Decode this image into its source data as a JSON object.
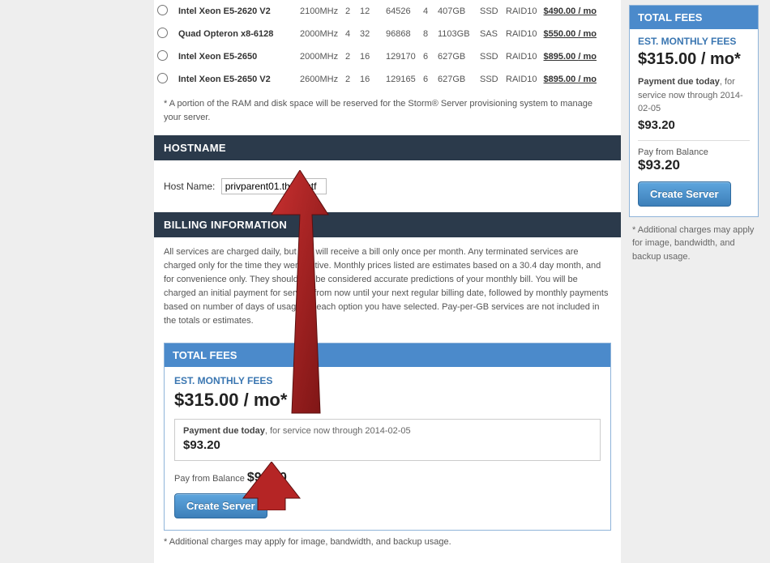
{
  "servers": [
    {
      "name": "Intel Xeon E5-2620 V2",
      "mhz": "2100MHz",
      "cpus": "2",
      "cores": "12",
      "ram": "64526",
      "drives": "4",
      "disk": "407GB",
      "type": "SSD",
      "raid": "RAID10",
      "price": "$490.00",
      "per": "/ mo"
    },
    {
      "name": "Quad Opteron x8-6128",
      "mhz": "2000MHz",
      "cpus": "4",
      "cores": "32",
      "ram": "96868",
      "drives": "8",
      "disk": "1103GB",
      "type": "SAS",
      "raid": "RAID10",
      "price": "$550.00",
      "per": "/ mo"
    },
    {
      "name": "Intel Xeon E5-2650",
      "mhz": "2000MHz",
      "cpus": "2",
      "cores": "16",
      "ram": "129170",
      "drives": "6",
      "disk": "627GB",
      "type": "SSD",
      "raid": "RAID10",
      "price": "$895.00",
      "per": "/ mo"
    },
    {
      "name": "Intel Xeon E5-2650 V2",
      "mhz": "2600MHz",
      "cpus": "2",
      "cores": "16",
      "ram": "129165",
      "drives": "6",
      "disk": "627GB",
      "type": "SSD",
      "raid": "RAID10",
      "price": "$895.00",
      "per": "/ mo"
    }
  ],
  "disclaimer": "* A portion of the RAM and disk space will be reserved for the Storm® Server provisioning system to manage your server.",
  "hostname": {
    "header": "HOSTNAME",
    "label": "Host Name:",
    "value": "privparent01.thebestf"
  },
  "billing": {
    "header": "BILLING INFORMATION",
    "text": "All services are charged daily, but you will receive a bill only once per month. Any terminated services are charged only for the time they were active. Monthly prices listed are estimates based on a 30.4 day month, and for convenience only. They should not be considered accurate predictions of your monthly bill. You will be charged an initial payment for service from now until your next regular billing date, followed by monthly payments based on number of days of usage for each option you have selected. Pay-per-GB services are not included in the totals or estimates."
  },
  "fees": {
    "header": "TOTAL FEES",
    "est_label": "EST. MONTHLY FEES",
    "est_price": "$315.00 / mo*",
    "payment_due_label": "Payment due today",
    "payment_due_suffix": ", for service now through 2014-02-05",
    "payment_amount": "$93.20",
    "payfrom_prefix": "Pay from ",
    "payfrom_label": "Balance",
    "payfrom_amount": "$93.20",
    "button": "Create Server",
    "additional": "* Additional charges may apply for image, bandwidth, and backup usage."
  }
}
